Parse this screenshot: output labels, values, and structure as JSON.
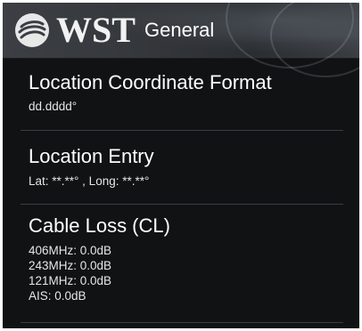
{
  "action_bar": {
    "logo_text": "WST",
    "title": "General",
    "logo_icon": "globe-swirl-icon"
  },
  "preferences": {
    "coordinate_format": {
      "title": "Location Coordinate Format",
      "summary": "dd.dddd°"
    },
    "location_entry": {
      "title": "Location Entry",
      "summary": "Lat: **.**° , Long: **.**°"
    },
    "cable_loss": {
      "title": "Cable Loss (CL)",
      "lines": [
        "406MHz: 0.0dB",
        "243MHz: 0.0dB",
        "121MHz: 0.0dB",
        "AIS: 0.0dB"
      ]
    }
  },
  "colors": {
    "background": "#101214",
    "action_bar": "#34373b",
    "text_primary": "#ffffff",
    "divider": "#3a3d40"
  }
}
